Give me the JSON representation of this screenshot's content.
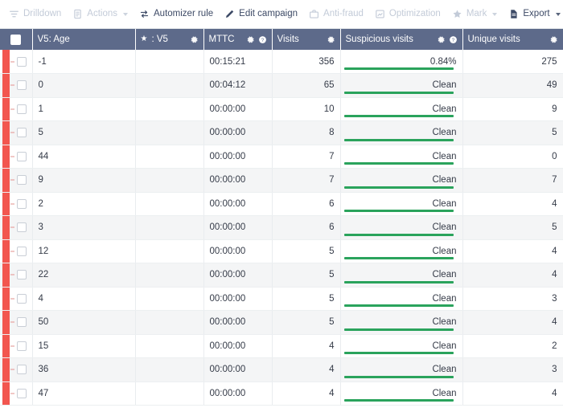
{
  "toolbar": {
    "items": [
      {
        "label": "Drilldown",
        "icon": "filter-icon",
        "disabled": true,
        "caret": false
      },
      {
        "label": "Actions",
        "icon": "document-icon",
        "disabled": true,
        "caret": true
      },
      {
        "label": "Automizer rule",
        "icon": "exchange-icon",
        "disabled": false,
        "caret": false
      },
      {
        "label": "Edit campaign",
        "icon": "pencil-icon",
        "disabled": false,
        "caret": false
      },
      {
        "label": "Anti-fraud",
        "icon": "briefcase-icon",
        "disabled": true,
        "caret": false
      },
      {
        "label": "Optimization",
        "icon": "chart-box-icon",
        "disabled": true,
        "caret": false
      },
      {
        "label": "Mark",
        "icon": "star-icon",
        "disabled": true,
        "caret": true
      },
      {
        "label": "Export",
        "icon": "export-doc-icon",
        "disabled": false,
        "caret": true
      }
    ]
  },
  "table": {
    "columns": [
      {
        "key": "select",
        "label": "",
        "align": "center",
        "gear": false,
        "help": false,
        "star": false
      },
      {
        "key": "age",
        "label": "V5: Age",
        "align": "left",
        "gear": false,
        "help": false,
        "star": false
      },
      {
        "key": "v5",
        "label": ": V5",
        "align": "left",
        "gear": true,
        "help": false,
        "star": true
      },
      {
        "key": "mttc",
        "label": "MTTC",
        "align": "left",
        "gear": true,
        "help": true,
        "star": false
      },
      {
        "key": "visits",
        "label": "Visits",
        "align": "left",
        "gear": true,
        "help": false,
        "star": false
      },
      {
        "key": "susp",
        "label": "Suspicious visits",
        "align": "left",
        "gear": true,
        "help": true,
        "star": false
      },
      {
        "key": "uniq",
        "label": "Unique visits",
        "align": "left",
        "gear": true,
        "help": false,
        "star": false
      }
    ],
    "rows": [
      {
        "age": "-1",
        "v5": "",
        "mttc": "00:15:21",
        "visits": "356",
        "susp": "0.84%",
        "susp_bar_pct": 96,
        "uniq": "275"
      },
      {
        "age": "0",
        "v5": "",
        "mttc": "00:04:12",
        "visits": "65",
        "susp": "Clean",
        "susp_bar_pct": 96,
        "uniq": "49"
      },
      {
        "age": "1",
        "v5": "",
        "mttc": "00:00:00",
        "visits": "10",
        "susp": "Clean",
        "susp_bar_pct": 96,
        "uniq": "9"
      },
      {
        "age": "5",
        "v5": "",
        "mttc": "00:00:00",
        "visits": "8",
        "susp": "Clean",
        "susp_bar_pct": 96,
        "uniq": "5"
      },
      {
        "age": "44",
        "v5": "",
        "mttc": "00:00:00",
        "visits": "7",
        "susp": "Clean",
        "susp_bar_pct": 96,
        "uniq": "0"
      },
      {
        "age": "9",
        "v5": "",
        "mttc": "00:00:00",
        "visits": "7",
        "susp": "Clean",
        "susp_bar_pct": 96,
        "uniq": "7"
      },
      {
        "age": "2",
        "v5": "",
        "mttc": "00:00:00",
        "visits": "6",
        "susp": "Clean",
        "susp_bar_pct": 96,
        "uniq": "4"
      },
      {
        "age": "3",
        "v5": "",
        "mttc": "00:00:00",
        "visits": "6",
        "susp": "Clean",
        "susp_bar_pct": 96,
        "uniq": "5"
      },
      {
        "age": "12",
        "v5": "",
        "mttc": "00:00:00",
        "visits": "5",
        "susp": "Clean",
        "susp_bar_pct": 96,
        "uniq": "4"
      },
      {
        "age": "22",
        "v5": "",
        "mttc": "00:00:00",
        "visits": "5",
        "susp": "Clean",
        "susp_bar_pct": 96,
        "uniq": "4"
      },
      {
        "age": "4",
        "v5": "",
        "mttc": "00:00:00",
        "visits": "5",
        "susp": "Clean",
        "susp_bar_pct": 96,
        "uniq": "3"
      },
      {
        "age": "50",
        "v5": "",
        "mttc": "00:00:00",
        "visits": "5",
        "susp": "Clean",
        "susp_bar_pct": 96,
        "uniq": "4"
      },
      {
        "age": "15",
        "v5": "",
        "mttc": "00:00:00",
        "visits": "4",
        "susp": "Clean",
        "susp_bar_pct": 96,
        "uniq": "2"
      },
      {
        "age": "36",
        "v5": "",
        "mttc": "00:00:00",
        "visits": "4",
        "susp": "Clean",
        "susp_bar_pct": 96,
        "uniq": "3"
      },
      {
        "age": "47",
        "v5": "",
        "mttc": "00:00:00",
        "visits": "4",
        "susp": "Clean",
        "susp_bar_pct": 96,
        "uniq": "4"
      }
    ]
  },
  "colors": {
    "header_bg": "#5d6a8a",
    "row_alt_bg": "#f4f5f6",
    "accent_red": "#f2564f",
    "bar_green": "#2aa35c",
    "toolbar_text": "#3d4a66",
    "toolbar_disabled": "#c3cbd8"
  }
}
